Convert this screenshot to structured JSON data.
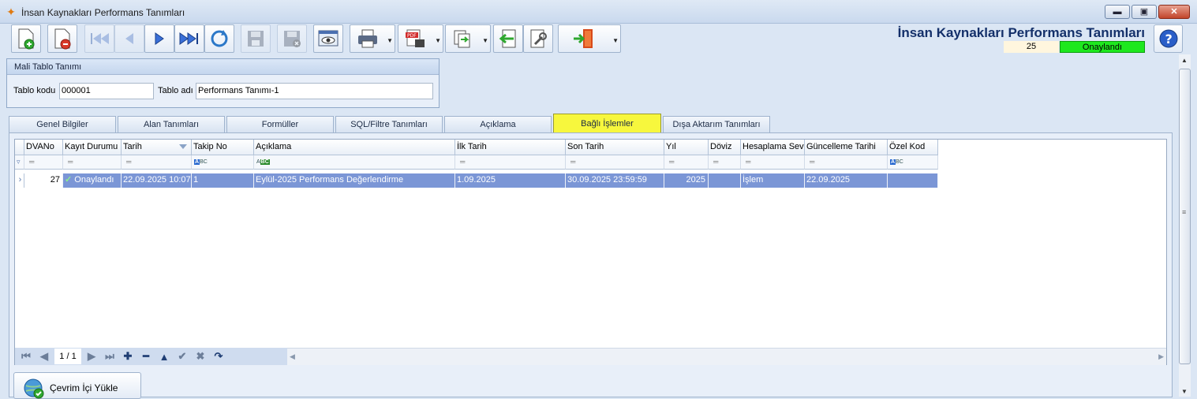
{
  "window": {
    "title": "İnsan Kaynakları Performans Tanımları",
    "minimize": "▬",
    "maximize": "▣",
    "close": "✕"
  },
  "header": {
    "title": "İnsan Kaynakları Performans Tanımları",
    "record_number": "25",
    "status": "Onaylandı",
    "status_color": "#1ee81e"
  },
  "toolbar": {
    "icons": [
      "new-document-icon",
      "delete-document-icon",
      "first-record-icon",
      "previous-record-icon",
      "next-record-icon",
      "last-record-icon",
      "refresh-icon",
      "save-icon",
      "cancel-save-icon",
      "preview-icon",
      "print-icon",
      "pdf-export-icon",
      "transfer-icon",
      "import-icon",
      "tools-icon",
      "exit-icon",
      "help-icon"
    ]
  },
  "groupbox": {
    "title": "Mali Tablo Tanımı",
    "code_label": "Tablo kodu",
    "code_value": "000001",
    "name_label": "Tablo adı",
    "name_value": "Performans Tanımı-1"
  },
  "tabs": [
    {
      "label": "Genel Bilgiler"
    },
    {
      "label": "Alan Tanımları"
    },
    {
      "label": "Formüller"
    },
    {
      "label": "SQL/Filtre Tanımları"
    },
    {
      "label": "Açıklama"
    },
    {
      "label": "Bağlı İşlemler"
    },
    {
      "label": "Dışa Aktarım Tanımları"
    }
  ],
  "active_tab_color": "#f7f73d",
  "grid": {
    "columns": [
      "DVANo",
      "Kayıt Durumu",
      "Tarih",
      "Takip No",
      "Açıklama",
      "İlk Tarih",
      "Son Tarih",
      "Yıl",
      "Döviz",
      "Hesaplama Sevi",
      "Güncelleme Tarihi",
      "Özel Kod"
    ],
    "filter_equals": "═",
    "filter_abc": "BC",
    "filter_a": "A",
    "rows": [
      {
        "dvano": "27",
        "status_check": "✓",
        "status": "Onaylandı",
        "tarih": "22.09.2025 10:07",
        "takip_no": "1",
        "aciklama": "Eylül-2025 Performans Değerlendirme",
        "ilk_tarih": "1.09.2025",
        "son_tarih": "30.09.2025 23:59:59",
        "yil": "2025",
        "doviz": "",
        "hesaplama": "İşlem",
        "guncelleme": "22.09.2025",
        "ozel_kod": ""
      }
    ],
    "selected_row_color": "#7b96d6",
    "pager": "1 / 1"
  },
  "footer": {
    "load_button": "Çevrim İçi Yükle"
  }
}
